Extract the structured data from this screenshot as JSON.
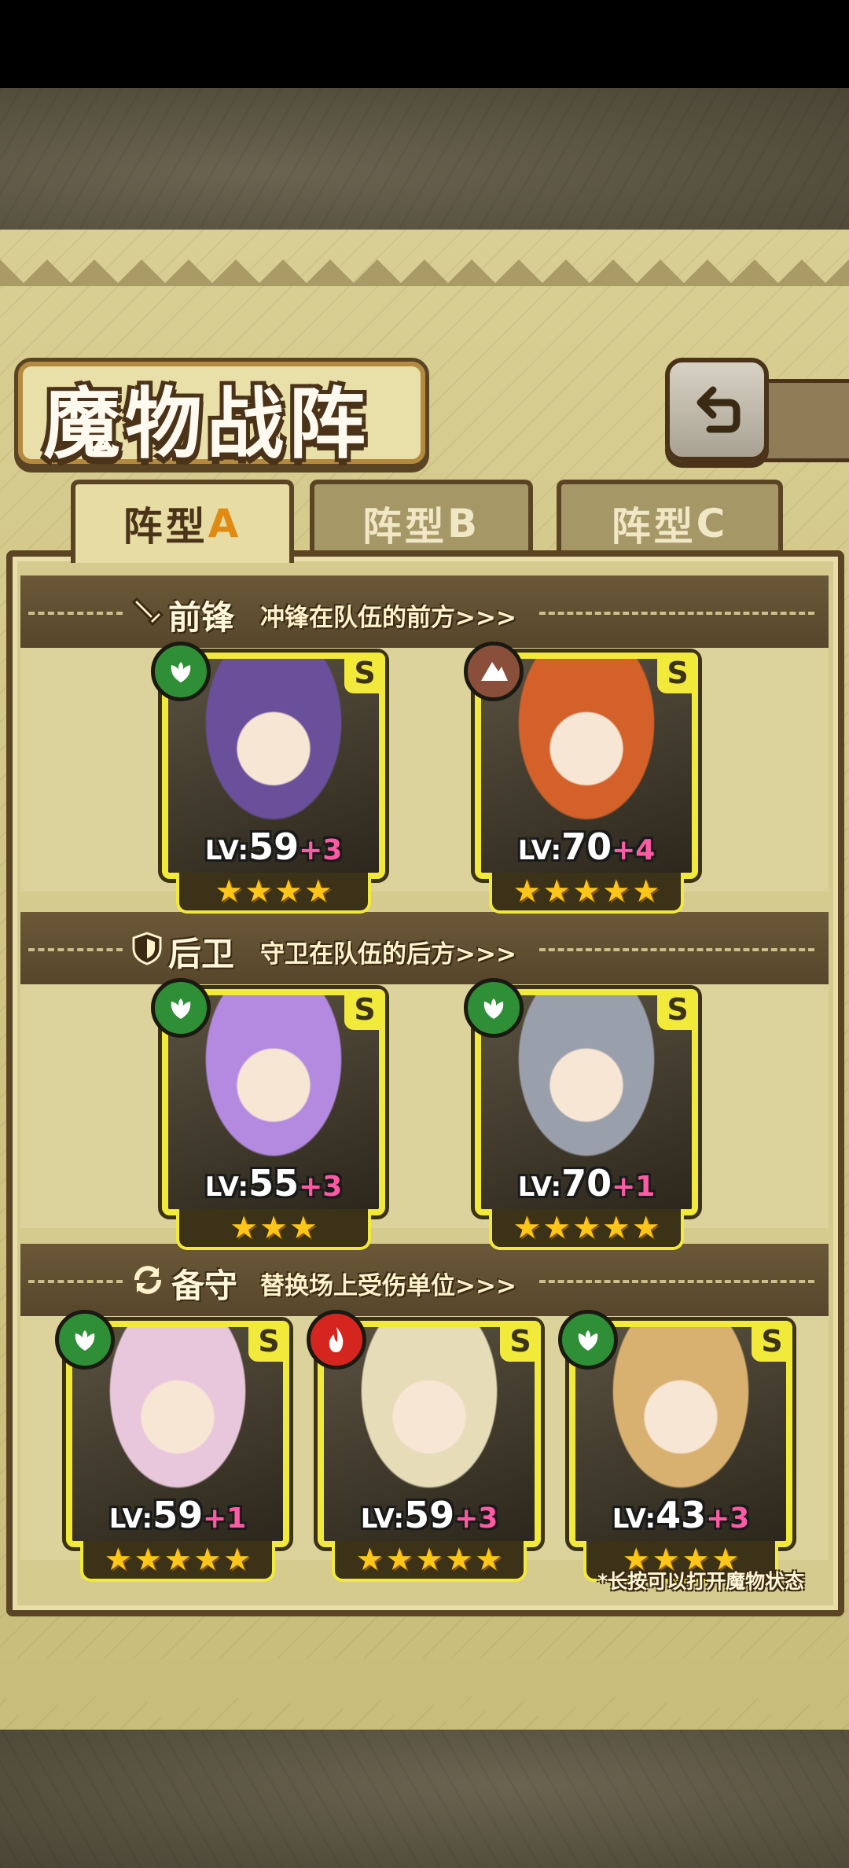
{
  "title": "魔物战阵",
  "tabs": [
    {
      "label": "阵型",
      "letter": "A",
      "active": true
    },
    {
      "label": "阵型",
      "letter": "B",
      "active": false
    },
    {
      "label": "阵型",
      "letter": "C",
      "active": false
    }
  ],
  "sections": {
    "front": {
      "icon": "sword-icon",
      "title": "前锋",
      "desc": "冲锋在队伍的前方>>>"
    },
    "back": {
      "icon": "shield-icon",
      "title": "后卫",
      "desc": "守卫在队伍的后方>>>"
    },
    "reserve": {
      "icon": "swap-icon",
      "title": "备守",
      "desc": "替换场上受伤单位>>>"
    }
  },
  "units": {
    "front_1": {
      "rank": "S",
      "element": "leaf",
      "lv_prefix": "LV:",
      "level": "59",
      "plus": "+3",
      "stars": 4,
      "accent": "#6a4f9a"
    },
    "front_2": {
      "rank": "S",
      "element": "earth",
      "lv_prefix": "LV:",
      "level": "70",
      "plus": "+4",
      "stars": 5,
      "accent": "#d4602a"
    },
    "back_1": {
      "rank": "S",
      "element": "leaf",
      "lv_prefix": "LV:",
      "level": "55",
      "plus": "+3",
      "stars": 3,
      "accent": "#b38ae0"
    },
    "back_2": {
      "rank": "S",
      "element": "leaf",
      "lv_prefix": "LV:",
      "level": "70",
      "plus": "+1",
      "stars": 5,
      "accent": "#9aa0ab"
    },
    "reserve_1": {
      "rank": "S",
      "element": "leaf",
      "lv_prefix": "LV:",
      "level": "59",
      "plus": "+1",
      "stars": 5,
      "accent": "#e8c7dc"
    },
    "reserve_2": {
      "rank": "S",
      "element": "fire",
      "lv_prefix": "LV:",
      "level": "59",
      "plus": "+3",
      "stars": 5,
      "accent": "#e6dcb8"
    },
    "reserve_3": {
      "rank": "S",
      "element": "leaf",
      "lv_prefix": "LV:",
      "level": "43",
      "plus": "+3",
      "stars": 4,
      "accent": "#d8b070"
    }
  },
  "footnote": "*长按可以打开魔物状态",
  "colors": {
    "leaf": "#2f8f36",
    "earth": "#8a4f3a",
    "fire": "#d4261f",
    "card_border": "#f2ea3a",
    "plus": "#ff5ba4"
  }
}
